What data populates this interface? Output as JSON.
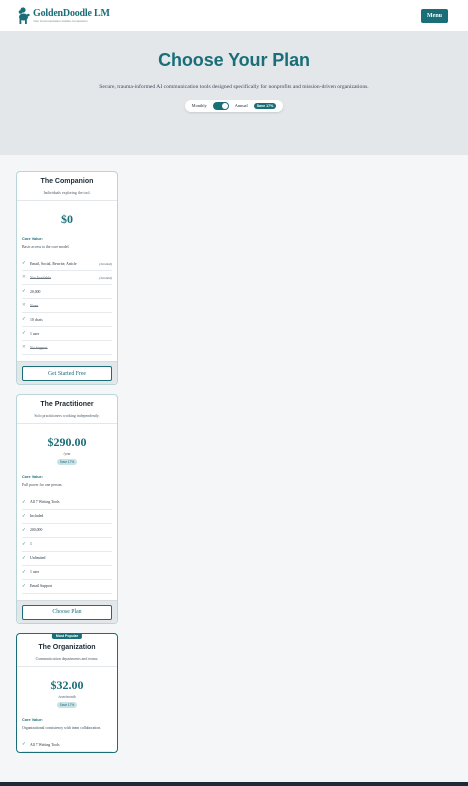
{
  "header": {
    "logo_name": "GoldenDoodle LM",
    "logo_tagline": "Your Communication Golden Companion",
    "menu_label": "Menu"
  },
  "hero": {
    "title": "Choose Your Plan",
    "subtitle": "Secure, trauma-informed AI communication tools designed specifically for nonprofits and mission-driven organizations.",
    "toggle": {
      "monthly_label": "Monthly",
      "annual_label": "Annual",
      "save_badge": "Save 17%",
      "selected": "Annual"
    }
  },
  "plans": [
    {
      "name": "The Companion",
      "audience": "Individuals exploring the tool.",
      "price": "$0",
      "period": "",
      "save": "",
      "core_label": "Core Value:",
      "core_text": "Basic access to the core model.",
      "features": [
        {
          "text": "Email, Social, Rewrite, Article",
          "included": true,
          "note": "(Limited)"
        },
        {
          "text": "Not Available",
          "included": false,
          "note": "(Limited)"
        },
        {
          "text": "20,000",
          "included": true,
          "note": ""
        },
        {
          "text": "None",
          "included": false,
          "note": ""
        },
        {
          "text": "10 chats",
          "included": true,
          "note": ""
        },
        {
          "text": "1 user",
          "included": true,
          "note": ""
        },
        {
          "text": "No Support",
          "included": false,
          "note": ""
        }
      ],
      "cta": "Get Started Free",
      "popular": ""
    },
    {
      "name": "The Practitioner",
      "audience": "Solo practitioners working independently.",
      "price": "$290.00",
      "period": "/year",
      "save": "Save 17%",
      "core_label": "Core Value:",
      "core_text": "Full power for one person.",
      "features": [
        {
          "text": "All 7 Writing Tools",
          "included": true,
          "note": ""
        },
        {
          "text": "Included",
          "included": true,
          "note": ""
        },
        {
          "text": "200,000",
          "included": true,
          "note": ""
        },
        {
          "text": "1",
          "included": true,
          "note": ""
        },
        {
          "text": "Unlimited",
          "included": true,
          "note": ""
        },
        {
          "text": "1 user",
          "included": true,
          "note": ""
        },
        {
          "text": "Email Support",
          "included": true,
          "note": ""
        }
      ],
      "cta": "Choose Plan",
      "popular": ""
    },
    {
      "name": "The Organization",
      "audience": "Communication departments and teams.",
      "price": "$32.00",
      "period": "/user/month",
      "save": "Save 17%",
      "core_label": "Core Value:",
      "core_text": "Organizational consistency with team collaboration.",
      "features": [
        {
          "text": "All 7 Writing Tools",
          "included": true,
          "note": ""
        }
      ],
      "cta": "",
      "popular": "Most Popular"
    }
  ],
  "colors": {
    "brand": "#1a6e78",
    "hero_bg": "#e3e7ea",
    "page_bg": "#f4f6f8"
  }
}
